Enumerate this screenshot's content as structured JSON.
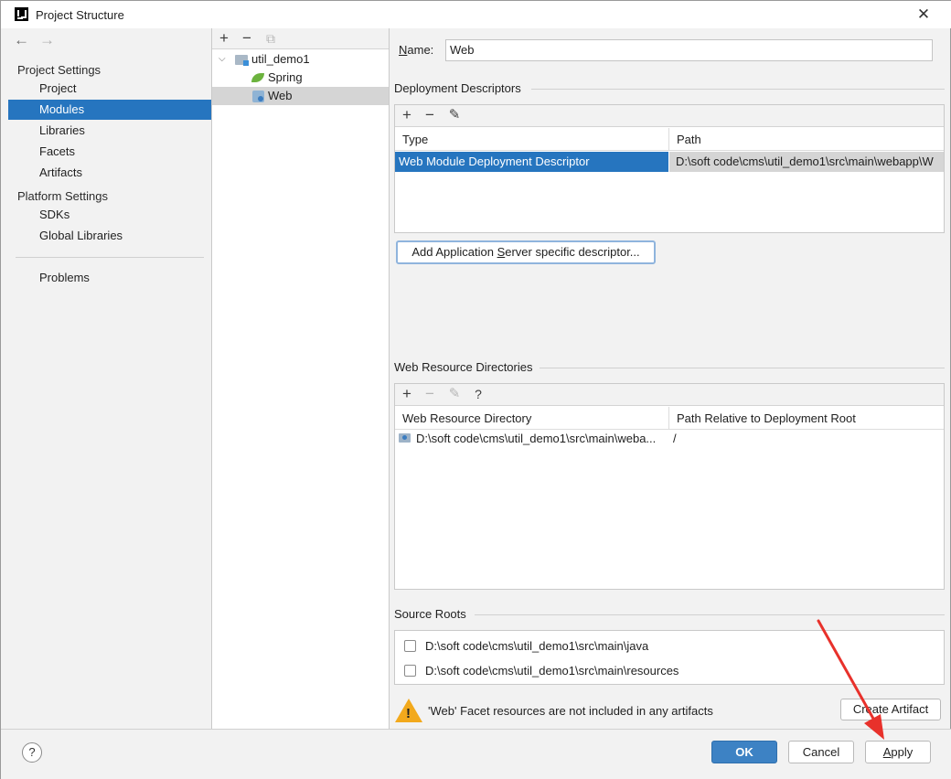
{
  "window": {
    "title": "Project Structure",
    "close_icon": "close-icon"
  },
  "nav": {
    "back": "←",
    "forward": "→"
  },
  "sidebar": {
    "project_settings_heading": "Project Settings",
    "project_items": [
      "Project",
      "Modules",
      "Libraries",
      "Facets",
      "Artifacts"
    ],
    "selected": "Modules",
    "platform_settings_heading": "Platform Settings",
    "platform_items": [
      "SDKs",
      "Global Libraries"
    ],
    "problems": "Problems"
  },
  "tree": {
    "toolbar": {
      "add": "+",
      "remove": "−",
      "copy": "⧉"
    },
    "root": "util_demo1",
    "children": [
      "Spring",
      "Web"
    ],
    "selected": "Web"
  },
  "main": {
    "name_label": "Name:",
    "name_value": "Web",
    "deployment": {
      "title": "Deployment Descriptors",
      "toolbar": {
        "add": "+",
        "remove": "−",
        "edit": "✎"
      },
      "columns": [
        "Type",
        "Path"
      ],
      "rows": [
        {
          "type": "Web Module Deployment Descriptor",
          "path": "D:\\soft code\\cms\\util_demo1\\src\\main\\webapp\\W"
        }
      ],
      "add_button": "Add Application Server specific descriptor..."
    },
    "resources": {
      "title": "Web Resource Directories",
      "toolbar": {
        "add": "+",
        "remove": "−",
        "edit": "✎",
        "help": "?"
      },
      "columns": [
        "Web Resource Directory",
        "Path Relative to Deployment Root"
      ],
      "rows": [
        {
          "directory": "D:\\soft code\\cms\\util_demo1\\src\\main\\weba...",
          "relative": "/"
        }
      ]
    },
    "source_roots": {
      "title": "Source Roots",
      "items": [
        {
          "path": "D:\\soft code\\cms\\util_demo1\\src\\main\\java",
          "checked": false
        },
        {
          "path": "D:\\soft code\\cms\\util_demo1\\src\\main\\resources",
          "checked": false
        }
      ]
    },
    "warning": {
      "icon": "warning-icon",
      "mark": "!",
      "text": "'Web' Facet resources are not included in any artifacts"
    },
    "create_artifact": "Create Artifact"
  },
  "footer": {
    "help": "?",
    "ok": "OK",
    "cancel": "Cancel",
    "apply": "Apply"
  },
  "colors": {
    "selection_blue": "#2675bf",
    "ok_button": "#3d82c4",
    "annotation_arrow": "#e8312b",
    "warning": "#f2a91c"
  }
}
